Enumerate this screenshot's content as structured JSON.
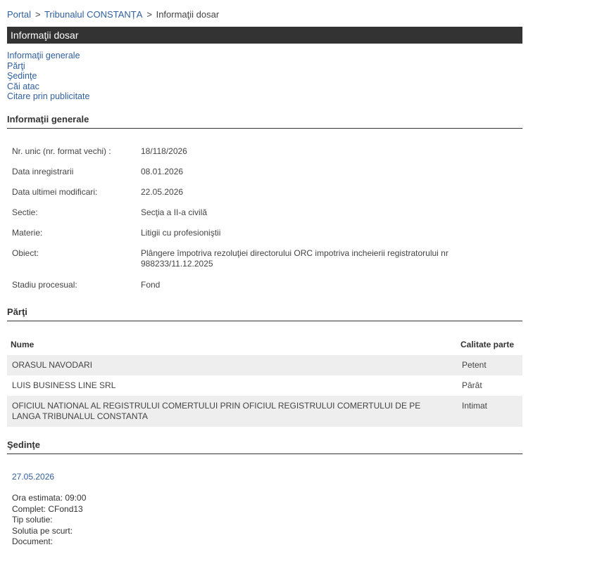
{
  "breadcrumb": {
    "portal": "Portal",
    "court": "Tribunalul CONSTANȚA",
    "current": "Informaţii dosar",
    "separator": ">"
  },
  "header": {
    "title": "Informaţii dosar"
  },
  "nav": {
    "items": [
      "Informaţii generale",
      "Părţi",
      "Şedinţe",
      "Căi atac",
      "Citare prin publicitate"
    ]
  },
  "general": {
    "title": "Informaţii generale",
    "rows": [
      {
        "label": "Nr. unic (nr. format vechi) :",
        "value": "18/118/2026"
      },
      {
        "label": "Data inregistrarii",
        "value": "08.01.2026"
      },
      {
        "label": "Data ultimei modificari:",
        "value": "22.05.2026"
      },
      {
        "label": "Sectie:",
        "value": "Secţia a II-a civilă"
      },
      {
        "label": "Materie:",
        "value": "Litigii cu profesioniştii"
      },
      {
        "label": "Obiect:",
        "value": "Plângere împotriva rezoluţiei directorului ORC impotriva incheierii registratorului nr 988233/11.12.2025"
      },
      {
        "label": "Stadiu procesual:",
        "value": "Fond"
      }
    ]
  },
  "parti": {
    "title": "Părţi",
    "headers": {
      "name": "Nume",
      "role": "Calitate parte"
    },
    "rows": [
      {
        "name": "ORASUL NAVODARI",
        "role": "Petent"
      },
      {
        "name": "LUIS BUSINESS LINE SRL",
        "role": "Pârât"
      },
      {
        "name": "OFICIUL NATIONAL AL REGISTRULUI COMERTULUI PRIN OFICIUL REGISTRULUI COMERTULUI DE PE LANGA TRIBUNALUL CONSTANTA",
        "role": "Intimat"
      }
    ]
  },
  "sedinte": {
    "title": "Şedinţe",
    "date": "27.05.2026",
    "details": [
      "Ora estimata: 09:00",
      "Complet: CFond13",
      "Tip solutie:",
      "Solutia pe scurt:",
      "Document:"
    ]
  },
  "colors": {
    "link": "#2f5f9f",
    "header_bg": "#333333",
    "row_shade": "#eeeeee"
  }
}
